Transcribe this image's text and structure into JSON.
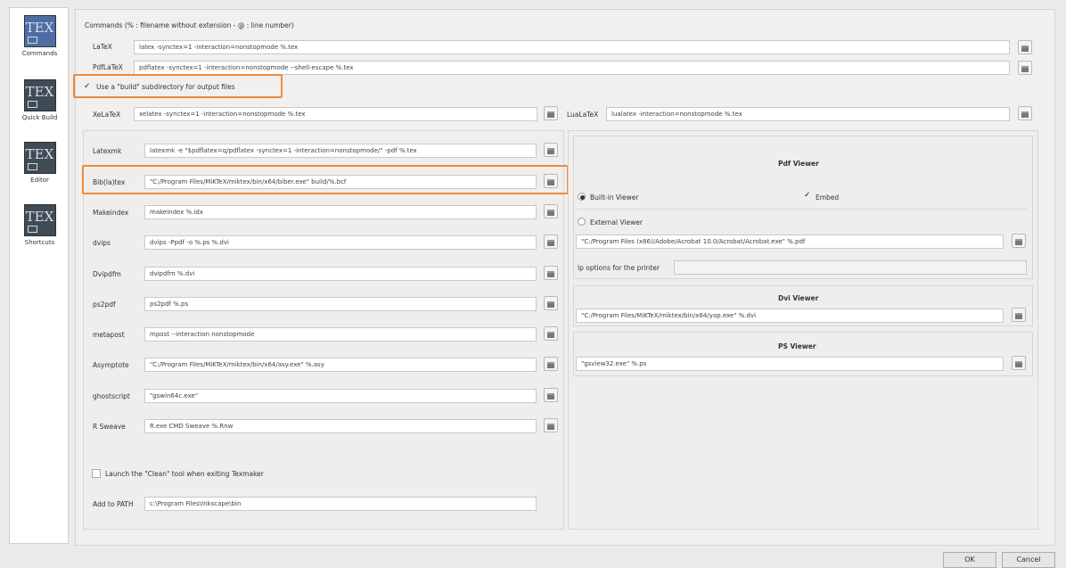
{
  "sidebar": {
    "items": [
      {
        "label": "Commands",
        "icon": "TEX"
      },
      {
        "label": "Quick Build",
        "icon": "TEX"
      },
      {
        "label": "Editor",
        "icon": "TEX"
      },
      {
        "label": "Shortcuts",
        "icon": "TEX"
      }
    ]
  },
  "commands": {
    "header": "Commands (% : filename without extension - @ : line number)",
    "latex": {
      "label": "LaTeX",
      "value": "latex -synctex=1 -interaction=nonstopmode %.tex"
    },
    "pdflatex": {
      "label": "PdfLaTeX",
      "value": "pdflatex -synctex=1 -interaction=nonstopmode --shell-escape %.tex"
    },
    "build_subdir": {
      "label": "Use a \"build\" subdirectory for output files",
      "checked": true
    },
    "xelatex": {
      "label": "XeLaTeX",
      "value": "xelatex -synctex=1 -interaction=nonstopmode %.tex"
    },
    "lualatex": {
      "label": "LuaLaTeX",
      "value": "lualatex -interaction=nonstopmode %.tex"
    },
    "latexmk": {
      "label": "Latexmk",
      "value": "latexmk -e \"$pdflatex=q/pdflatex -synctex=1 -interaction=nonstopmode/\" -pdf %.tex"
    },
    "bibtex": {
      "label": "Bib(la)tex",
      "value": "\"C:/Program Files/MiKTeX/miktex/bin/x64/biber.exe\" build/%.bcf"
    },
    "makeindex": {
      "label": "Makeindex",
      "value": "makeindex %.idx"
    },
    "dvips": {
      "label": "dvips",
      "value": "dvips -Ppdf -o %.ps %.dvi"
    },
    "dvipdfm": {
      "label": "Dvipdfm",
      "value": "dvipdfm %.dvi"
    },
    "ps2pdf": {
      "label": "ps2pdf",
      "value": "ps2pdf %.ps"
    },
    "metapost": {
      "label": "metapost",
      "value": "mpost --interaction nonstopmode"
    },
    "asymptote": {
      "label": "Asymptote",
      "value": "\"C:/Program Files/MiKTeX/miktex/bin/x64/asy.exe\" %.asy"
    },
    "ghostscript": {
      "label": "ghostscript",
      "value": "\"gswin64c.exe\""
    },
    "rsweave": {
      "label": "R Sweave",
      "value": "R.exe CMD Sweave %.Rnw"
    },
    "clean_tool": {
      "label": "Launch the \"Clean\" tool when exiting Texmaker",
      "checked": false
    },
    "path": {
      "label": "Add to PATH",
      "value": "c:\\Program Files\\Inkscape\\bin"
    }
  },
  "pdf_viewer": {
    "title": "Pdf Viewer",
    "builtin_label": "Built-in Viewer",
    "embed_label": "Embed",
    "embed_checked": true,
    "external_label": "External Viewer",
    "external_value": "\"C:/Program Files (x86)/Adobe/Acrobat 10.0/Acrobat/Acrobat.exe\" %.pdf",
    "lp_label": "lp options for the printer",
    "lp_value": ""
  },
  "dvi_viewer": {
    "title": "Dvi Viewer",
    "value": "\"C:/Program Files/MiKTeX/miktex/bin/x64/yap.exe\" %.dvi"
  },
  "ps_viewer": {
    "title": "PS Viewer",
    "value": "\"gsview32.exe\" %.ps"
  },
  "dialog": {
    "ok": "OK",
    "cancel": "Cancel"
  },
  "colors": {
    "highlight": "#ef8a3a",
    "selected_icon": "#4e6ea3"
  }
}
